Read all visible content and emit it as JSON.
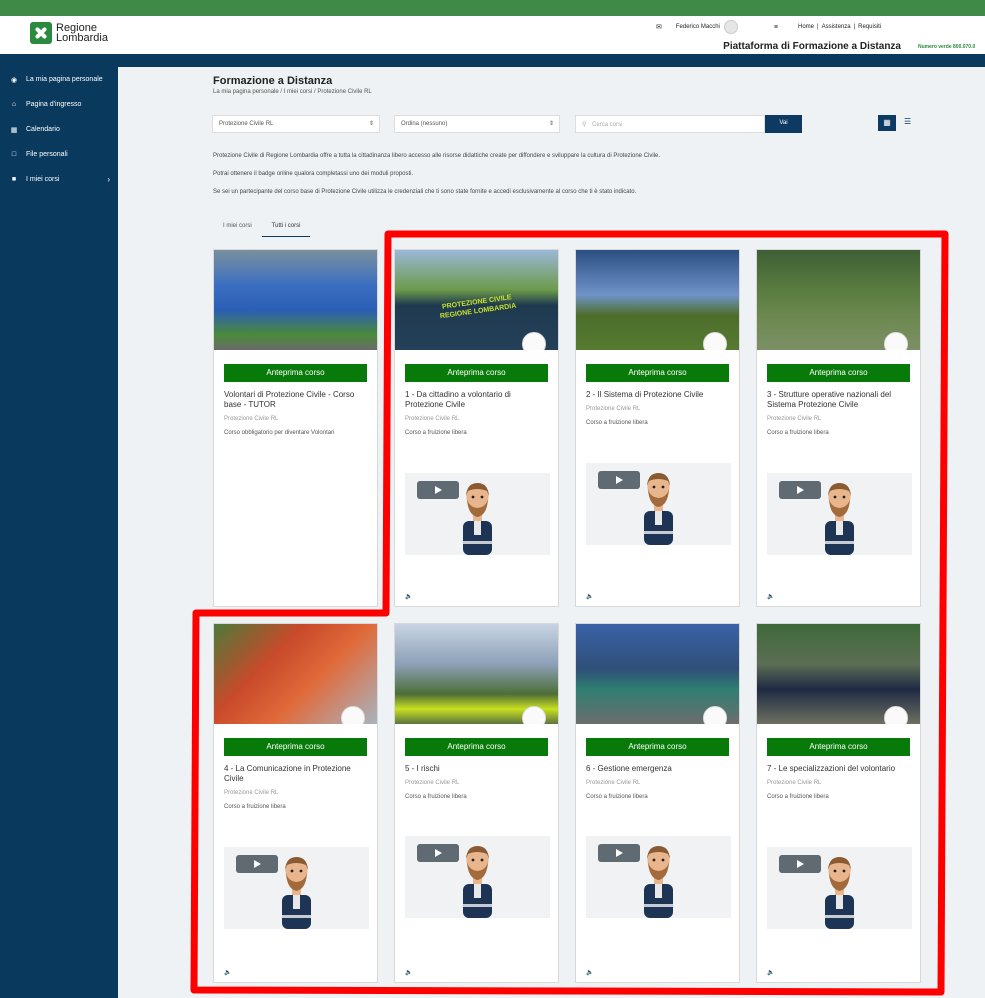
{
  "header": {
    "logo_line1": "Regione",
    "logo_line2": "Lombardia",
    "user_name": "Federico Macchi",
    "links": [
      "Home",
      "Assistenza",
      "Requisiti"
    ],
    "platform_title": "Piattaforma di Formazione a Distanza",
    "numero_verde": "Numero verde 800.070.0"
  },
  "sidebar": {
    "items": [
      {
        "label": "La mia pagina personale",
        "icon": "dashboard-icon"
      },
      {
        "label": "Pagina d'ingresso",
        "icon": "home-icon"
      },
      {
        "label": "Calendario",
        "icon": "calendar-icon"
      },
      {
        "label": "File personali",
        "icon": "file-icon"
      },
      {
        "label": "I miei corsi",
        "icon": "courses-icon"
      }
    ]
  },
  "page": {
    "title": "Formazione a Distanza",
    "breadcrumb": "La mia pagina personale  /  I miei corsi  /  Protezione Civile RL"
  },
  "filters": {
    "category_value": "Protezione Civile RL",
    "sort_value": "Ordina (nessuno)",
    "search_placeholder": "Cerca corsi",
    "search_button": "Vai"
  },
  "intro": [
    "Protezione Civile di Regione Lombardia offre a tutta la cittadinanza libero accesso alle risorse didattiche create per diffondere e sviluppare la cultura di Protezione Civile.",
    "Potrai ottenere il badge online qualora completassi uno dei moduli proposti.",
    "Se sei un partecipante del corso base di Protezione Civile utilizza le credenziali che ti sono state fornite e accedi esclusivamente al corso che ti è stato indicato."
  ],
  "tabs": [
    {
      "label": "I miei corsi",
      "active": false
    },
    {
      "label": "Tutti i corsi",
      "active": true
    }
  ],
  "preview_label": "Anteprima corso",
  "courses": [
    {
      "title": "Volontari di Protezione Civile - Corso base - TUTOR",
      "category": "Protezione Civile RL",
      "desc": "Corso obbligatorio per diventare Volontari"
    },
    {
      "title": "1 - Da cittadino a volontario di Protezione Civile",
      "category": "Protezione Civile RL",
      "desc": "Corso a fruizione libera"
    },
    {
      "title": "2 - Il Sistema di Protezione Civile",
      "category": "Protezione Civile RL",
      "desc": "Corso a fruizione libera"
    },
    {
      "title": "3 - Strutture operative nazionali del Sistema Protezione Civile",
      "category": "Protezione Civile RL",
      "desc": "Corso a fruizione libera"
    },
    {
      "title": "4 - La Comunicazione in Protezione Civile",
      "category": "Protezione Civile RL",
      "desc": "Corso a fruizione libera"
    },
    {
      "title": "5 - I rischi",
      "category": "Protezione Civile RL",
      "desc": "Corso a fruizione libera"
    },
    {
      "title": "6 - Gestione emergenza",
      "category": "Protezione Civile RL",
      "desc": "Corso a fruizione libera"
    },
    {
      "title": "7 - Le specializzazioni del volontario",
      "category": "Protezione Civile RL",
      "desc": "Corso a fruizione libera"
    }
  ],
  "vest_text_line1": "PROTEZIONE CIVILE",
  "vest_text_line2": "REGIONE LOMBARDIA",
  "colors": {
    "accent": "#087a0a",
    "navy": "#093a5e",
    "annotation": "#ff0000"
  }
}
